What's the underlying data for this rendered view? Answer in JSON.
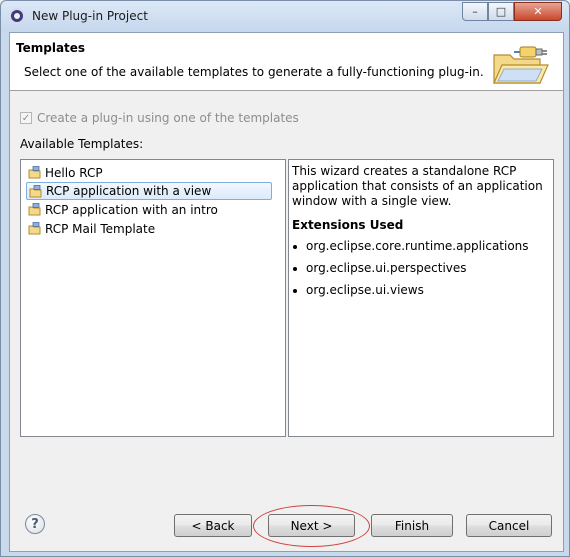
{
  "window": {
    "title": "New Plug-in Project"
  },
  "banner": {
    "title": "Templates",
    "description": "Select one of the available templates to generate a fully-functioning plug-in."
  },
  "options": {
    "use_template_label": "Create a plug-in using one of the templates",
    "use_template_checked": true,
    "use_template_enabled": false
  },
  "templates": {
    "label": "Available Templates:",
    "items": [
      {
        "label": "Hello RCP",
        "selected": false
      },
      {
        "label": "RCP application with a view",
        "selected": true
      },
      {
        "label": "RCP application with an intro",
        "selected": false
      },
      {
        "label": "RCP Mail Template",
        "selected": false
      }
    ]
  },
  "description": {
    "text": "This wizard creates a standalone RCP application that consists of an application window with a single view.",
    "extensions_heading": "Extensions Used",
    "extensions": [
      "org.eclipse.core.runtime.applications",
      "org.eclipse.ui.perspectives",
      "org.eclipse.ui.views"
    ]
  },
  "buttons": {
    "help": "?",
    "back": "< Back",
    "next": "Next >",
    "finish": "Finish",
    "cancel": "Cancel"
  },
  "titlebar_buttons": {
    "minimize": "–",
    "maximize": "□",
    "close": "✕"
  },
  "icons": {
    "app": "eclipse-icon",
    "banner": "plugin-folder-icon",
    "template_item": "plugin-template-icon"
  },
  "colors": {
    "selection_fill": "#dbeafb",
    "selection_border": "#84acdd",
    "highlight_ellipse": "#d04040",
    "close_button": "#c7482d"
  }
}
